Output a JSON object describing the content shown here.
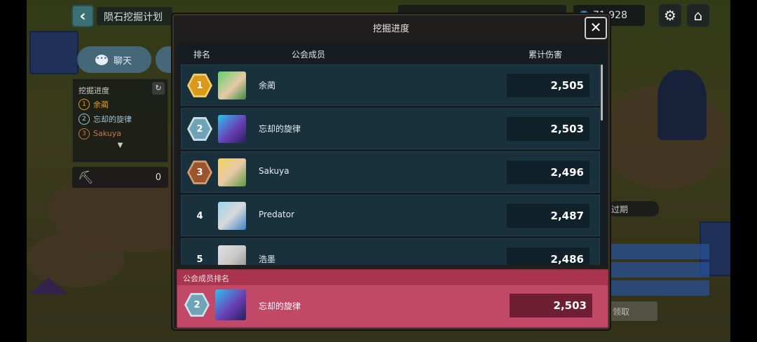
{
  "header": {
    "title": "陨石挖掘计划",
    "gems": "71,928"
  },
  "left": {
    "chat_label": "聊天",
    "dig_title": "挖掘进度",
    "dig_list": [
      {
        "rank": "1",
        "name": "余蔺",
        "color": "#e0a31c"
      },
      {
        "rank": "2",
        "name": "忘却的旋律",
        "color": "#9ec4d8"
      },
      {
        "rank": "3",
        "name": "Sakuya",
        "color": "#c7794a"
      }
    ],
    "pickaxe_count": "0"
  },
  "right": {
    "expire_label": "过期",
    "claim_label": "领取"
  },
  "modal": {
    "title": "挖掘进度",
    "col_rank": "排名",
    "col_member": "公会成员",
    "col_damage": "累计伤害",
    "rows": [
      {
        "rank": "1",
        "name": "余蔺",
        "damage": "2,505",
        "badge": "gold"
      },
      {
        "rank": "2",
        "name": "忘却的旋律",
        "damage": "2,503",
        "badge": "silver"
      },
      {
        "rank": "3",
        "name": "Sakuya",
        "damage": "2,496",
        "badge": "bronze"
      },
      {
        "rank": "4",
        "name": "Predator",
        "damage": "2,487",
        "badge": "none"
      },
      {
        "rank": "5",
        "name": "浩墨",
        "damage": "2,486",
        "badge": "none"
      }
    ],
    "self_section_title": "公会成员排名",
    "self": {
      "rank": "2",
      "name": "忘却的旋律",
      "damage": "2,503"
    }
  },
  "colors": {
    "gold": "#d99a1c",
    "silver": "#6fa3b8",
    "bronze": "#9a5530",
    "self_bg": "#c24867"
  }
}
